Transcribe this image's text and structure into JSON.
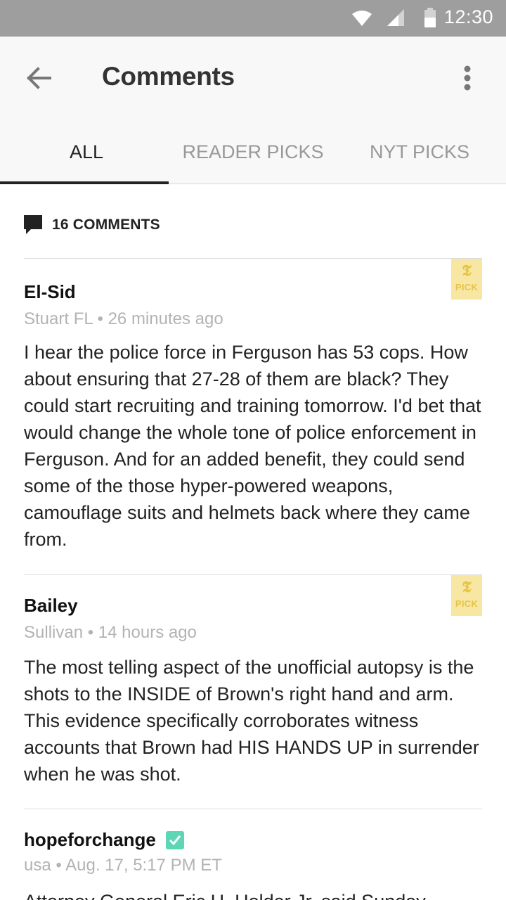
{
  "status_bar": {
    "time": "12:30"
  },
  "app_bar": {
    "title": "Comments"
  },
  "tabs": [
    {
      "label": "ALL",
      "active": true
    },
    {
      "label": "READER PICKS",
      "active": false
    },
    {
      "label": "NYT PICKS",
      "active": false
    }
  ],
  "comment_count_label": "16 COMMENTS",
  "pick_badge": {
    "label": "PICK"
  },
  "comments": [
    {
      "author": "El-Sid",
      "location": "Stuart FL",
      "time": "26 minutes ago",
      "nyt_pick": true,
      "verified": false,
      "body": "I hear the police force in Ferguson has 53 cops. How about ensuring that 27-28 of them are black? They could start recruiting and training tomorrow. I'd bet that would change the whole tone of police enforcement in Ferguson. And for an added benefit, they could send some of the those hyper-powered weapons, camouflage suits and helmets back where they came from."
    },
    {
      "author": "Bailey",
      "location": "Sullivan",
      "time": "14 hours ago",
      "nyt_pick": true,
      "verified": false,
      "body": "The most telling aspect of the unofficial autopsy is the shots to the INSIDE of Brown's right hand and arm. This evidence specifically corroborates witness accounts that Brown had HIS HANDS UP in surrender when he was shot."
    },
    {
      "author": "hopeforchange",
      "location": "usa",
      "time": "Aug. 17, 5:17 PM ET",
      "nyt_pick": false,
      "verified": true,
      "body": "Attorney General Eric H. Holder Jr. said Sunday"
    }
  ],
  "colors": {
    "status_bar": "#9e9e9e",
    "app_bar": "#f8f8f8",
    "pick_badge_bg": "#f7e7a3",
    "pick_badge_fg": "#e6c44a",
    "verified": "#5cd6b4",
    "meta_text": "#b3b3b3"
  },
  "icons": {
    "back": "arrow-left-icon",
    "menu": "more-vertical-icon",
    "comments": "comment-bubble-icon",
    "verified": "check-badge-icon"
  }
}
